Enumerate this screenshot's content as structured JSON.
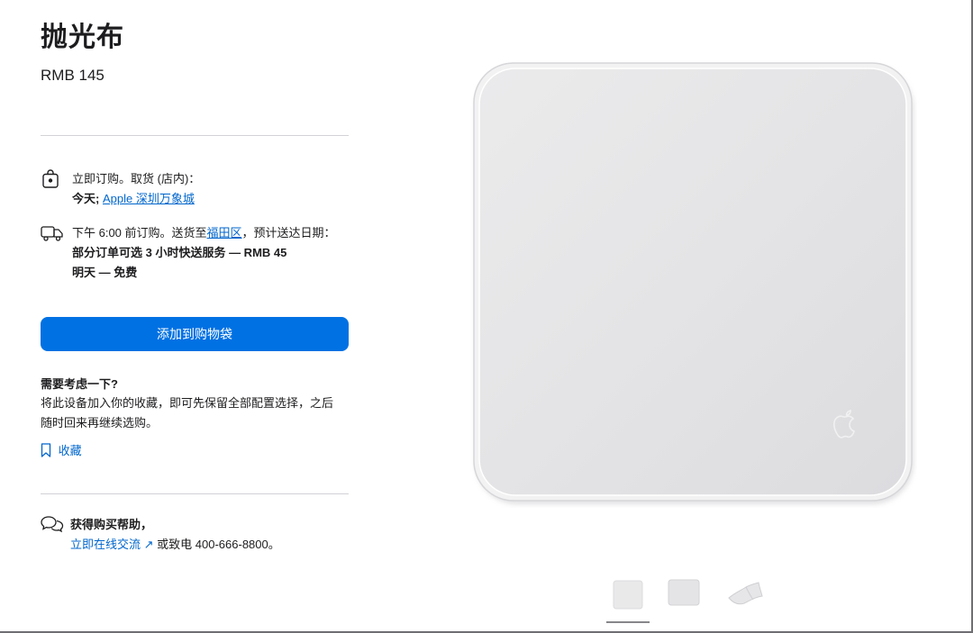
{
  "product": {
    "title": "抛光布",
    "price": "RMB 145"
  },
  "pickup": {
    "line1": "立即订购。取货 (店内)：",
    "day": "今天;",
    "store_link": "Apple 深圳万象城"
  },
  "delivery": {
    "line1_prefix": "下午 6:00 前订购。送货至",
    "district_link": "福田区",
    "line1_suffix": "，预计送达日期：",
    "option_fast": "部分订单可选 3 小时快送服务 — RMB 45",
    "option_free": "明天 — 免费"
  },
  "add_to_bag": {
    "label": "添加到购物袋"
  },
  "consider": {
    "title": "需要考虑一下?",
    "body": "将此设备加入你的收藏，即可先保留全部配置选择，之后随时回来再继续选购。",
    "save_label": "收藏"
  },
  "help": {
    "title": "获得购买帮助，",
    "chat_link": "立即在线交流",
    "chat_arrow": "↗",
    "phone_text": "或致电 400-666-8800。"
  },
  "icons": {
    "bag": "shopping-bag-icon",
    "truck": "delivery-truck-icon",
    "bookmark": "bookmark-icon",
    "chat": "chat-bubbles-icon",
    "logo": "apple-logo-icon"
  },
  "gallery": {
    "thumbnail_count": 3,
    "selected_index": 0
  }
}
